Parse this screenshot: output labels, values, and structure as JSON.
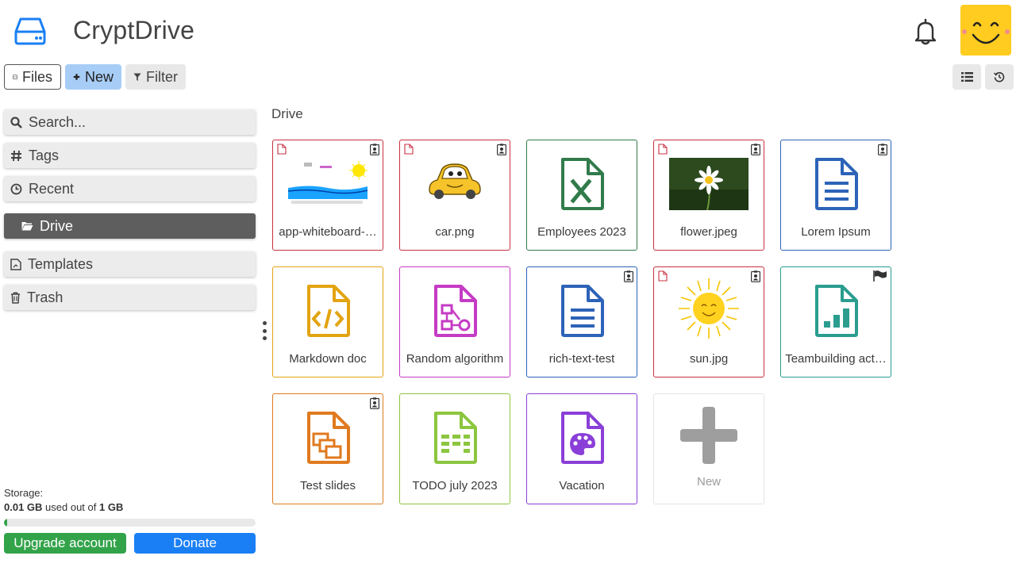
{
  "header": {
    "app_title": "CryptDrive"
  },
  "toolbar": {
    "files_label": "Files",
    "new_label": "New",
    "filter_label": "Filter"
  },
  "sidebar": {
    "items": [
      {
        "label": "Search...",
        "icon": "search-icon"
      },
      {
        "label": "Tags",
        "icon": "hash-icon"
      },
      {
        "label": "Recent",
        "icon": "clock-icon"
      },
      {
        "label": "Drive",
        "icon": "folder-open-icon",
        "active": true
      },
      {
        "label": "Templates",
        "icon": "template-icon"
      },
      {
        "label": "Trash",
        "icon": "trash-icon"
      }
    ]
  },
  "storage": {
    "label": "Storage:",
    "used": "0.01 GB",
    "used_text": " used out of ",
    "total": "1 GB",
    "used_fraction": 0.01,
    "upgrade_label": "Upgrade account",
    "donate_label": "Donate"
  },
  "main": {
    "breadcrumb": "Drive",
    "files": [
      {
        "name": "app-whiteboard-…",
        "type": "image",
        "color": "#c8303f",
        "badge": "owner"
      },
      {
        "name": "car.png",
        "type": "image",
        "color": "#c8303f",
        "badge": "owner"
      },
      {
        "name": "Employees 2023",
        "type": "sheet",
        "color": "#317b4b"
      },
      {
        "name": "flower.jpeg",
        "type": "image",
        "color": "#c8303f",
        "badge": "owner"
      },
      {
        "name": "Lorem Ipsum",
        "type": "richtext",
        "color": "#2d63b8",
        "badge": "owner"
      },
      {
        "name": "Markdown doc",
        "type": "code",
        "color": "#e3a412"
      },
      {
        "name": "Random algorithm",
        "type": "diagram",
        "color": "#c53bc5"
      },
      {
        "name": "rich-text-test",
        "type": "richtext",
        "color": "#2d63b8",
        "badge": "owner"
      },
      {
        "name": "sun.jpg",
        "type": "image",
        "color": "#c8303f",
        "badge": "owner"
      },
      {
        "name": "Teambuilding act…",
        "type": "form",
        "color": "#2a9d8f",
        "badge": "flag"
      },
      {
        "name": "Test slides",
        "type": "slides",
        "color": "#e07a1f",
        "badge": "owner"
      },
      {
        "name": "TODO july 2023",
        "type": "kanban",
        "color": "#8cc63f"
      },
      {
        "name": "Vacation",
        "type": "whiteboard",
        "color": "#8a3fd8"
      }
    ],
    "new_tile_label": "New"
  },
  "colors": {
    "accent": "#1a7ff5",
    "new_button": "#a7cdf7",
    "upgrade": "#33a34a",
    "avatar": "#ffcc1f"
  }
}
